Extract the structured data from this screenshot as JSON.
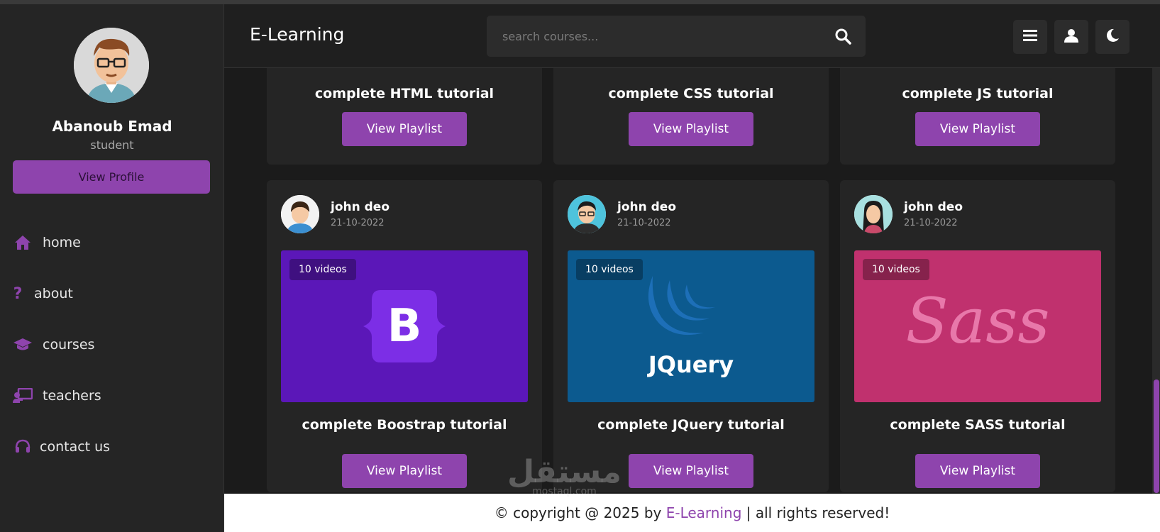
{
  "header": {
    "brand": "E-Learning",
    "search_placeholder": "search courses..."
  },
  "sidebar": {
    "profile_name": "Abanoub Emad",
    "profile_role": "student",
    "view_profile_label": "View Profile",
    "nav": [
      {
        "label": "home",
        "icon": "home-icon"
      },
      {
        "label": "about",
        "icon": "question-icon"
      },
      {
        "label": "courses",
        "icon": "graduation-cap-icon"
      },
      {
        "label": "teachers",
        "icon": "chalkboard-teacher-icon"
      },
      {
        "label": "contact us",
        "icon": "headset-icon"
      }
    ]
  },
  "courses_top": [
    {
      "title": "complete HTML tutorial",
      "button": "View Playlist",
      "color": "#e44d26"
    },
    {
      "title": "complete CSS tutorial",
      "button": "View Playlist",
      "color": "#1572b6"
    },
    {
      "title": "complete JS tutorial",
      "button": "View Playlist",
      "color": "#e8861b"
    }
  ],
  "courses": [
    {
      "tutor": "john deo",
      "date": "21-10-2022",
      "videos": "10 videos",
      "title": "complete Boostrap tutorial",
      "button": "View Playlist",
      "logo_text": "B",
      "color": "#5b17b8"
    },
    {
      "tutor": "john deo",
      "date": "21-10-2022",
      "videos": "10 videos",
      "title": "complete JQuery tutorial",
      "button": "View Playlist",
      "logo_text": "JQuery",
      "color": "#0c5a8f"
    },
    {
      "tutor": "john deo",
      "date": "21-10-2022",
      "videos": "10 videos",
      "title": "complete SASS tutorial",
      "button": "View Playlist",
      "logo_text": "Sass",
      "color": "#c0316e"
    }
  ],
  "footer": {
    "prefix": "© copyright @ 2025 by ",
    "brand": "E-Learning",
    "suffix": " | all rights reserved!"
  },
  "watermark": {
    "main": "مستقل",
    "sub": "mostaql.com"
  },
  "colors": {
    "accent": "#8e44ad",
    "background": "#1b1b1b",
    "panel": "#252525"
  }
}
